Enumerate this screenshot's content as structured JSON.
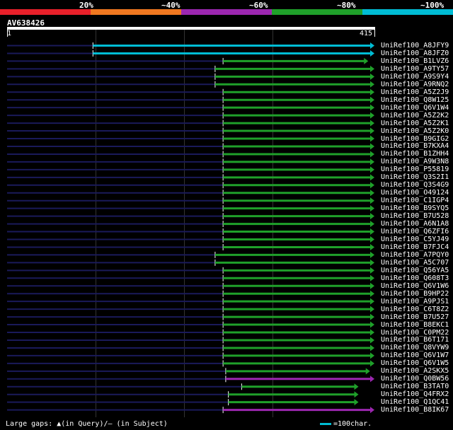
{
  "legend": {
    "labels": [
      "20%",
      "~40%",
      "~60%",
      "~80%",
      "~100%"
    ],
    "colors": [
      "#e8202a",
      "#f07820",
      "#9c27b0",
      "#1fa02a",
      "#00bcd4"
    ]
  },
  "query": {
    "id": "AV638426",
    "start": "1",
    "end": "415",
    "length": 415
  },
  "hits": [
    {
      "name": "UniRef100_A8JFY9",
      "start": 97,
      "end": 415,
      "color": "#00bcd4"
    },
    {
      "name": "UniRef100_A8JFZ0",
      "start": 97,
      "end": 415,
      "color": "#00bcd4"
    },
    {
      "name": "UniRef100_B1LVZ6",
      "start": 244,
      "end": 408,
      "color": "#1fa02a"
    },
    {
      "name": "UniRef100_A9TY57",
      "start": 235,
      "end": 415,
      "color": "#1fa02a"
    },
    {
      "name": "UniRef100_A9S9Y4",
      "start": 235,
      "end": 415,
      "color": "#1fa02a"
    },
    {
      "name": "UniRef100_A9RNQ2",
      "start": 235,
      "end": 415,
      "color": "#1fa02a"
    },
    {
      "name": "UniRef100_A5Z2J9",
      "start": 244,
      "end": 415,
      "color": "#1fa02a"
    },
    {
      "name": "UniRef100_Q8W125",
      "start": 244,
      "end": 415,
      "color": "#1fa02a"
    },
    {
      "name": "UniRef100_Q6V1W4",
      "start": 244,
      "end": 415,
      "color": "#1fa02a"
    },
    {
      "name": "UniRef100_A5Z2K2",
      "start": 244,
      "end": 415,
      "color": "#1fa02a"
    },
    {
      "name": "UniRef100_A5Z2K1",
      "start": 244,
      "end": 415,
      "color": "#1fa02a"
    },
    {
      "name": "UniRef100_A5Z2K0",
      "start": 244,
      "end": 415,
      "color": "#1fa02a"
    },
    {
      "name": "UniRef100_B9GIG2",
      "start": 244,
      "end": 415,
      "color": "#1fa02a"
    },
    {
      "name": "UniRef100_B7KXA4",
      "start": 244,
      "end": 415,
      "color": "#1fa02a"
    },
    {
      "name": "UniRef100_B1ZHH4",
      "start": 244,
      "end": 415,
      "color": "#1fa02a"
    },
    {
      "name": "UniRef100_A9W3N8",
      "start": 244,
      "end": 415,
      "color": "#1fa02a"
    },
    {
      "name": "UniRef100_P55819",
      "start": 244,
      "end": 415,
      "color": "#1fa02a"
    },
    {
      "name": "UniRef100_Q3S2I1",
      "start": 244,
      "end": 415,
      "color": "#1fa02a"
    },
    {
      "name": "UniRef100_Q3S4G9",
      "start": 244,
      "end": 415,
      "color": "#1fa02a"
    },
    {
      "name": "UniRef100_O49124",
      "start": 244,
      "end": 415,
      "color": "#1fa02a"
    },
    {
      "name": "UniRef100_C1IGP4",
      "start": 244,
      "end": 415,
      "color": "#1fa02a"
    },
    {
      "name": "UniRef100_B9SYQ5",
      "start": 244,
      "end": 415,
      "color": "#1fa02a"
    },
    {
      "name": "UniRef100_B7U528",
      "start": 244,
      "end": 415,
      "color": "#1fa02a"
    },
    {
      "name": "UniRef100_A6N1A8",
      "start": 244,
      "end": 415,
      "color": "#1fa02a"
    },
    {
      "name": "UniRef100_Q6ZFI6",
      "start": 244,
      "end": 415,
      "color": "#1fa02a"
    },
    {
      "name": "UniRef100_C5YJ49",
      "start": 244,
      "end": 415,
      "color": "#1fa02a"
    },
    {
      "name": "UniRef100_B7FJC4",
      "start": 244,
      "end": 415,
      "color": "#1fa02a"
    },
    {
      "name": "UniRef100_A7PQY0",
      "start": 235,
      "end": 415,
      "color": "#1fa02a"
    },
    {
      "name": "UniRef100_A5C707",
      "start": 235,
      "end": 415,
      "color": "#1fa02a"
    },
    {
      "name": "UniRef100_Q56YA5",
      "start": 244,
      "end": 415,
      "color": "#1fa02a"
    },
    {
      "name": "UniRef100_Q608T3",
      "start": 244,
      "end": 415,
      "color": "#1fa02a"
    },
    {
      "name": "UniRef100_Q6V1W6",
      "start": 244,
      "end": 415,
      "color": "#1fa02a"
    },
    {
      "name": "UniRef100_B9HP22",
      "start": 244,
      "end": 415,
      "color": "#1fa02a"
    },
    {
      "name": "UniRef100_A9PJS1",
      "start": 244,
      "end": 415,
      "color": "#1fa02a"
    },
    {
      "name": "UniRef100_C6T8Z2",
      "start": 244,
      "end": 415,
      "color": "#1fa02a"
    },
    {
      "name": "UniRef100_B7U527",
      "start": 244,
      "end": 415,
      "color": "#1fa02a"
    },
    {
      "name": "UniRef100_B8EKC1",
      "start": 244,
      "end": 415,
      "color": "#1fa02a"
    },
    {
      "name": "UniRef100_C0PM22",
      "start": 244,
      "end": 415,
      "color": "#1fa02a"
    },
    {
      "name": "UniRef100_B6T171",
      "start": 244,
      "end": 415,
      "color": "#1fa02a"
    },
    {
      "name": "UniRef100_Q8VYW9",
      "start": 244,
      "end": 415,
      "color": "#1fa02a"
    },
    {
      "name": "UniRef100_Q6V1W7",
      "start": 244,
      "end": 415,
      "color": "#1fa02a"
    },
    {
      "name": "UniRef100_Q6V1W5",
      "start": 244,
      "end": 415,
      "color": "#1fa02a"
    },
    {
      "name": "UniRef100_A2SKX5",
      "start": 247,
      "end": 410,
      "color": "#1fa02a"
    },
    {
      "name": "UniRef100_Q0BW56",
      "start": 247,
      "end": 415,
      "color": "#9c27b0"
    },
    {
      "name": "UniRef100_B3TAT0",
      "start": 265,
      "end": 397,
      "color": "#1fa02a"
    },
    {
      "name": "UniRef100_Q4FRX2",
      "start": 250,
      "end": 397,
      "color": "#1fa02a"
    },
    {
      "name": "UniRef100_Q1QC41",
      "start": 250,
      "end": 397,
      "color": "#1fa02a"
    },
    {
      "name": "UniRef100_B8IK67",
      "start": 244,
      "end": 415,
      "color": "#9c27b0"
    }
  ],
  "footer": {
    "gaps_text": "Large gaps: ▲(in Query)/– (in Subject)",
    "scale_text": "=100char."
  }
}
